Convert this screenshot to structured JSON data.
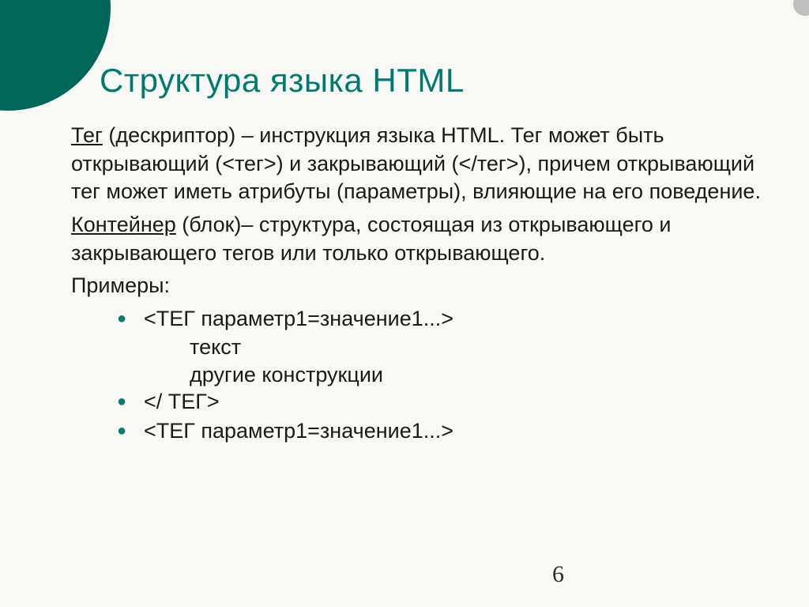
{
  "title": "Структура языка HTML",
  "para1_u": "Тег",
  "para1_rest": " (дескриптор) – инструкция языка HTML. Тег может быть открывающий (<тег>) и закрывающий (</тег>), причем открывающий тег может иметь атрибуты (параметры), влияющие на его поведение.",
  "para2_u": "Контейнер",
  "para2_rest": " (блок)– структура, состоящая из открывающего и закрывающего тегов или только открывающего.",
  "examples_label": "Примеры:",
  "bullet1_line1": "<ТЕГ параметр1=значение1...>",
  "bullet1_line2": "текст",
  "bullet1_line3": "другие конструкции",
  "bullet2": "</ ТЕГ>",
  "bullet3": "<ТЕГ параметр1=значение1...>",
  "page_number": "6"
}
